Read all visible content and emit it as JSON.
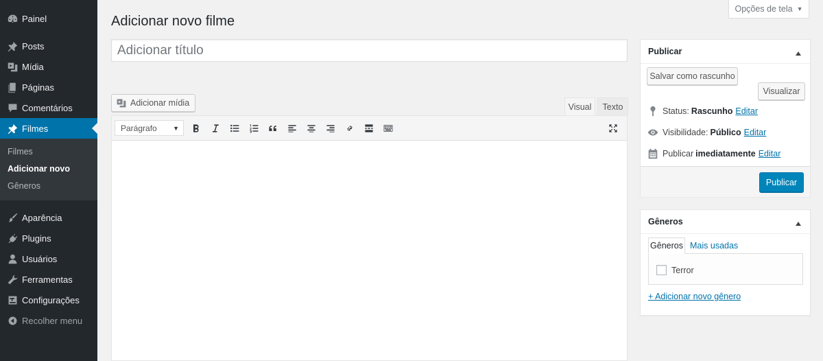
{
  "sidebar": {
    "items": [
      {
        "label": "Painel",
        "icon": "dashboard-icon"
      },
      {
        "label": "Posts",
        "icon": "pin-icon"
      },
      {
        "label": "Mídia",
        "icon": "media-icon"
      },
      {
        "label": "Páginas",
        "icon": "page-icon"
      },
      {
        "label": "Comentários",
        "icon": "comment-icon"
      },
      {
        "label": "Filmes",
        "icon": "pin-icon",
        "active": true
      },
      {
        "label": "Aparência",
        "icon": "brush-icon"
      },
      {
        "label": "Plugins",
        "icon": "plugin-icon"
      },
      {
        "label": "Usuários",
        "icon": "user-icon"
      },
      {
        "label": "Ferramentas",
        "icon": "wrench-icon"
      },
      {
        "label": "Configurações",
        "icon": "settings-icon"
      },
      {
        "label": "Recolher menu",
        "icon": "collapse-icon"
      }
    ],
    "submenu": [
      "Filmes",
      "Adicionar novo",
      "Gêneros"
    ]
  },
  "screen_options": "Opções de tela",
  "page_title": "Adicionar novo filme",
  "title_placeholder": "Adicionar título",
  "add_media": "Adicionar mídia",
  "editor_tabs": {
    "visual": "Visual",
    "text": "Texto"
  },
  "format_select": "Parágrafo",
  "publish": {
    "title": "Publicar",
    "save_draft": "Salvar como rascunho",
    "preview": "Visualizar",
    "status_label": "Status:",
    "status_value": "Rascunho",
    "visibility_label": "Visibilidade:",
    "visibility_value": "Público",
    "schedule_label": "Publicar",
    "schedule_value": "imediatamente",
    "edit": "Editar",
    "publish_button": "Publicar"
  },
  "genres": {
    "title": "Gêneros",
    "tab_all": "Gêneros",
    "tab_popular": "Mais usadas",
    "items": [
      "Terror"
    ],
    "add_new": "+ Adicionar novo gênero"
  },
  "colors": {
    "accent": "#0073aa",
    "sidebar": "#23282d",
    "publish_button": "#0085ba"
  }
}
